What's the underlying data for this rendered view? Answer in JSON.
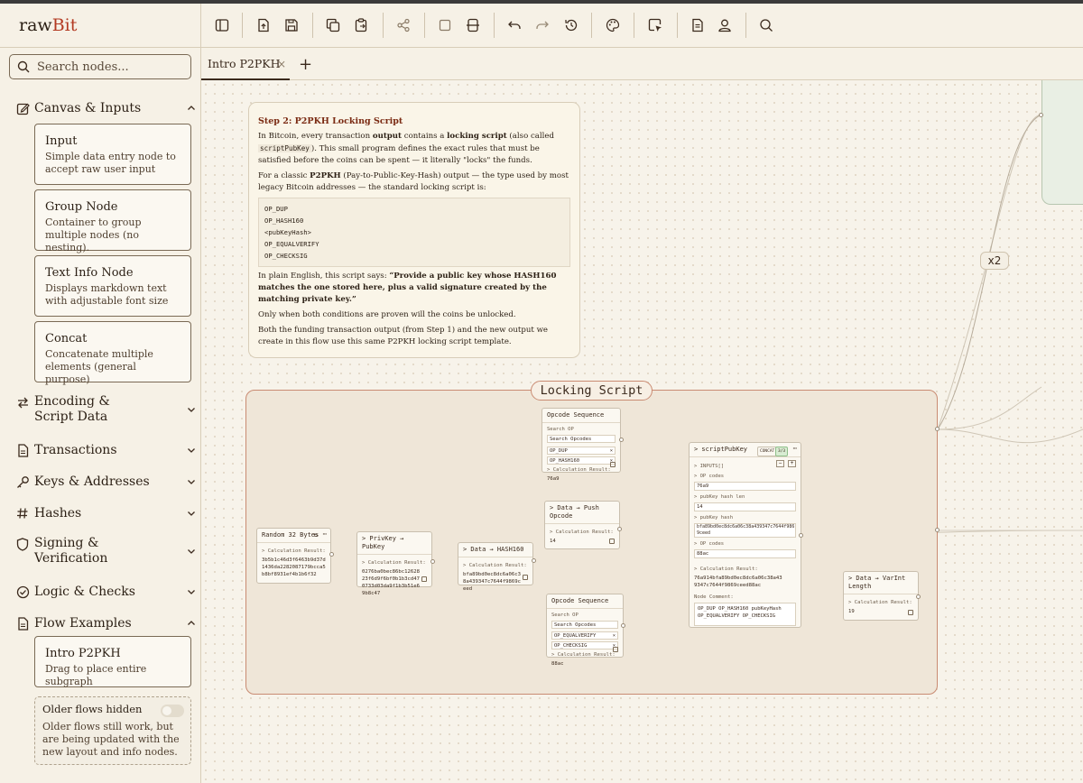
{
  "app": {
    "brand_prefix": "raw",
    "brand_suffix": "Bit"
  },
  "search": {
    "placeholder": "Search nodes..."
  },
  "sidebar": {
    "categories": [
      {
        "label": "Canvas & Inputs",
        "icon": "pencil-square-icon",
        "expanded": true
      },
      {
        "label": "Encoding & Script Data",
        "icon": "arrows-exchange-icon",
        "expanded": false
      },
      {
        "label": "Transactions",
        "icon": "file-icon",
        "expanded": false
      },
      {
        "label": "Keys & Addresses",
        "icon": "key-icon",
        "expanded": false
      },
      {
        "label": "Hashes",
        "icon": "hash-icon",
        "expanded": false
      },
      {
        "label": "Signing & Verification",
        "icon": "shield-icon",
        "expanded": false
      },
      {
        "label": "Logic & Checks",
        "icon": "check-circle-icon",
        "expanded": false
      },
      {
        "label": "Flow Examples",
        "icon": "file-icon",
        "expanded": true
      }
    ],
    "canvas_items": [
      {
        "title": "Input",
        "desc": "Simple data entry node to accept raw user input"
      },
      {
        "title": "Group Node",
        "desc": "Container to group multiple nodes (no nesting)."
      },
      {
        "title": "Text Info Node",
        "desc": "Displays markdown text with adjustable font size"
      },
      {
        "title": "Concat",
        "desc": "Concatenate multiple elements (general purpose)"
      }
    ],
    "flow_items": [
      {
        "title": "Intro P2PKH",
        "desc": "Drag to place entire subgraph"
      }
    ],
    "older": {
      "title": "Older flows hidden",
      "desc": "Older flows still work, but are being updated with the new layout and info nodes.",
      "enabled": false
    }
  },
  "tabs": [
    {
      "label": "Intro P2PKH",
      "close": "×"
    }
  ],
  "tab_add": "+",
  "info_node": {
    "title": "Step 2: P2PKH Locking Script",
    "p1a": "In Bitcoin, every transaction ",
    "p1b": "output",
    "p1c": " contains a ",
    "p1d": "locking script",
    "p1e": " (also called ",
    "p1code": "scriptPubKey",
    "p1f": "). This small program defines the exact rules that must be satisfied before the coins can be spent — it literally \"locks\" the funds.",
    "p2a": "For a classic ",
    "p2b": "P2PKH",
    "p2c": " (Pay-to-Public-Key-Hash) output — the type used by most legacy Bitcoin addresses — the standard locking script is:",
    "script": "OP_DUP\nOP_HASH160\n<pubKeyHash>\nOP_EQUALVERIFY\nOP_CHECKSIG",
    "p3a": "In plain English, this script says: ",
    "p3b": "“Provide a public key whose HASH160 matches the one stored here, plus a valid signature created by the matching private key.”",
    "p4": "Only when both conditions are proven will the coins be unlocked.",
    "p5": "Both the funding transaction output (from Step 1) and the new output we create in this flow use this same P2PKH locking script template."
  },
  "group": {
    "title": "Locking Script"
  },
  "edge_badge": "x2",
  "nodes": {
    "random": {
      "title": "Random 32 Bytes",
      "res_label": "> Calculation Result:",
      "value": "3b5b1c46d3f6463b9d37d1436da2282087179bcca5b8bf8931ef4b1b6f32"
    },
    "privkey": {
      "title": "> PrivKey → PubKey",
      "res_label": "> Calculation Result:",
      "value": "0276ba0bec86bc1262823f6d9f6bf0b1b3cd470733d03da9f1b3b51e69b8c47"
    },
    "hash160": {
      "title": "> Data → HASH160",
      "res_label": "> Calculation Result:",
      "value": "bfa89bd0ec8dc6a06c38a439347c7644f9869ceed"
    },
    "opseq1": {
      "title": "Opcode Sequence",
      "search_label": "Search OP",
      "search_ph": "Search Opcodes",
      "items": [
        "OP_DUP",
        "OP_HASH160"
      ],
      "res_label": "> Calculation Result:",
      "value": "76a9"
    },
    "push": {
      "title": "> Data → Push Opcode",
      "res_label": "> Calculation Result:",
      "value": "14"
    },
    "opseq2": {
      "title": "Opcode Sequence",
      "search_label": "Search OP",
      "search_ph": "Search Opcodes",
      "items": [
        "OP_EQUALVERIFY",
        "OP_CHECKSIG"
      ],
      "res_label": "> Calculation Result:",
      "value": "88ac"
    },
    "spk": {
      "title": "> scriptPubKey",
      "badge1": "CONCAT",
      "badge2": "3/3",
      "inputs_label": "> INPUTS[]",
      "f1_label": "> OP codes",
      "f1": "76a9",
      "f2_label": "> pubKey hash len",
      "f2": "14",
      "f3_label": "> pubKey hash",
      "f3": "bfa89bd0ec8dc6a06c38a439347c7644f9869ceed",
      "f4_label": "> OP codes",
      "f4": "88ac",
      "res_label": "> Calculation Result:",
      "value": "76a914bfa89bd0ec8dc6a06c38a439347c7644f9869ceed88ac",
      "comment_label": "Node Comment:",
      "comment": "OP_DUP OP_HASH160 pubKeyHash OP_EQUALVERIFY OP_CHECKSIG"
    },
    "varint": {
      "title": "> Data → VarInt Length",
      "res_label": "> Calculation Result:",
      "value": "19"
    }
  },
  "colors": {
    "accent": "#b33a22",
    "group_border": "#c98b72",
    "background": "#f7f3ea"
  }
}
